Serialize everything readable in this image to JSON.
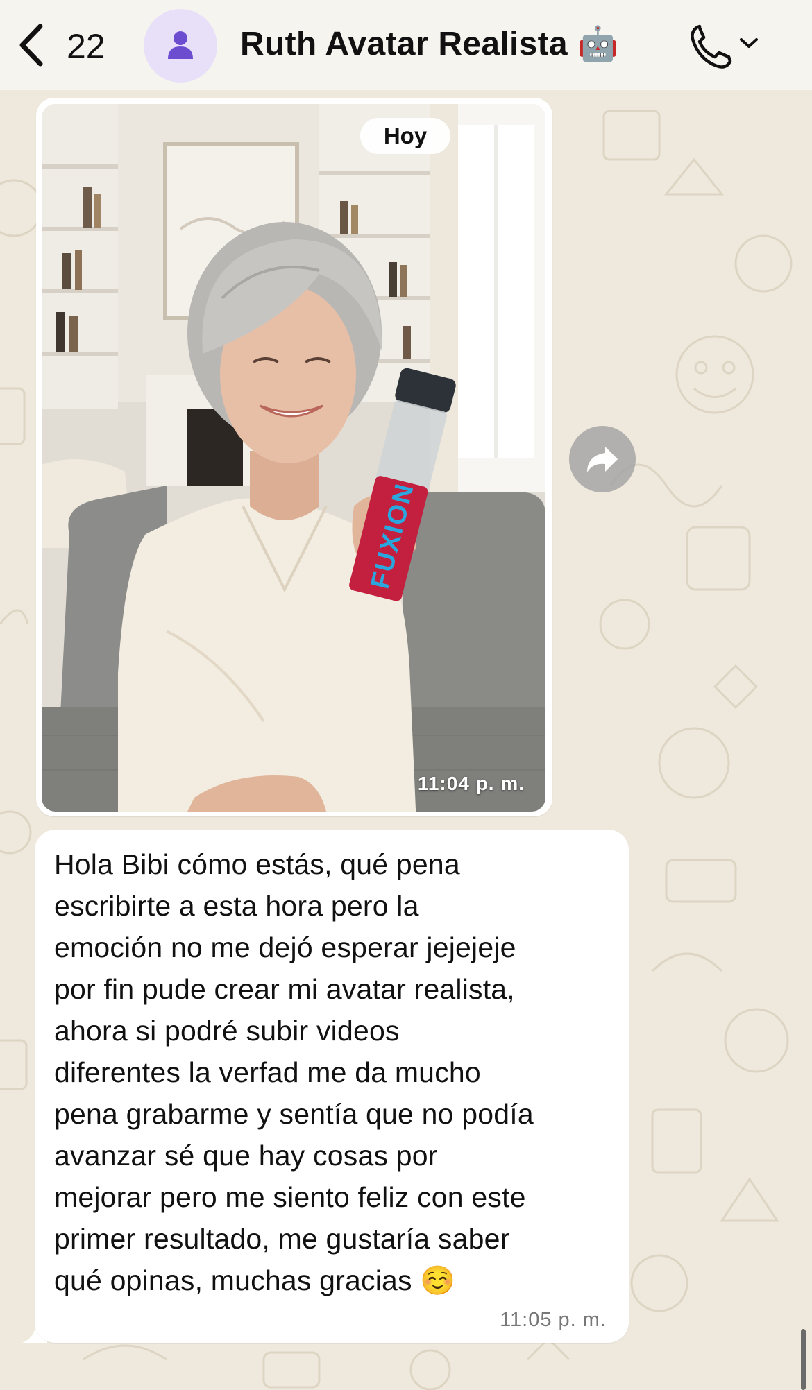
{
  "header": {
    "back_count": "22",
    "contact_name": "Ruth Avatar Realista",
    "contact_emoji": "🤖"
  },
  "chat": {
    "date_chip": "Hoy",
    "messages": [
      {
        "type": "image",
        "bottle_text": "FUXION",
        "time": "11:04 p. m."
      },
      {
        "type": "text",
        "lines": [
          "Hola Bibi cómo estás, qué pena",
          "escribirte a esta hora pero la",
          "emoción no me dejó esperar jejejeje",
          "por fin pude crear mi avatar realista,",
          "ahora si podré subir videos",
          "diferentes la verfad me da mucho",
          "pena grabarme y sentía que no podía",
          "avanzar sé que hay cosas por",
          "mejorar pero me siento feliz con este",
          "primer resultado, me gustaría saber",
          "qué opinas, muchas gracias ☺️"
        ],
        "time": "11:05 p. m."
      }
    ]
  },
  "colors": {
    "wallpaper": "#efe9dd",
    "bubble": "#ffffff",
    "avatar_bg": "#e8e0f9",
    "avatar_icon": "#6c4ccf"
  }
}
